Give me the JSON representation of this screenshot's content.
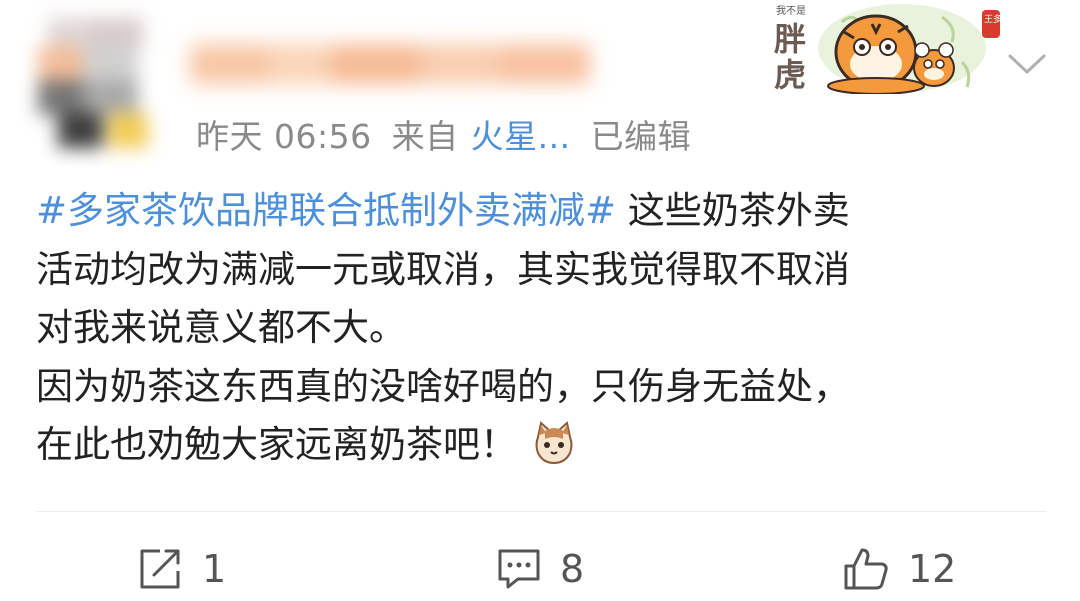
{
  "post": {
    "author_avatar": "blurred-avatar",
    "author_name": "",
    "time": "昨天 06:56",
    "source_prefix": "来自",
    "source": "火星...",
    "edited": "已编辑",
    "badge": {
      "icon": "fat-tiger-badge-icon",
      "label": "胖虎",
      "small_text": "我不是",
      "seal": "王多"
    },
    "content": {
      "topic": "#多家茶饮品牌联合抵制外卖满减#",
      "line1_rest": " 这些奶茶外卖",
      "line2": "活动均改为满减一元或取消，其实我觉得取不取消",
      "line3": "对我来说意义都不大。",
      "line4": "因为奶茶这东西真的没啥好喝的，只伤身无益处，",
      "line5": "在此也劝勉大家远离奶茶吧！",
      "emoji": "cat-emoji-icon"
    }
  },
  "actions": {
    "repost": {
      "icon": "share-icon",
      "count": "1"
    },
    "comment": {
      "icon": "comment-icon",
      "count": "8"
    },
    "like": {
      "icon": "thumbs-up-icon",
      "count": "12"
    }
  },
  "colors": {
    "link": "#4d8fd9",
    "meta": "#8a8a8a",
    "text": "#222222",
    "action": "#555555"
  }
}
